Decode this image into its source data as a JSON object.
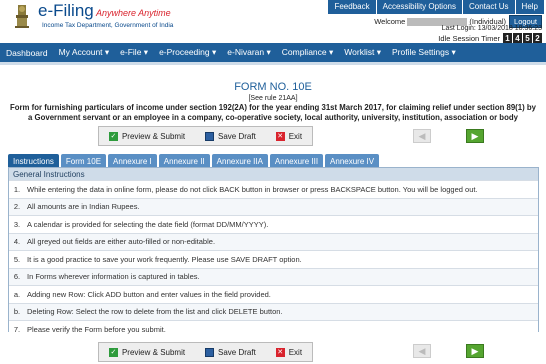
{
  "brand": {
    "name": "e-Filing",
    "tagline": "Anywhere Anytime",
    "subtitle": "Income Tax Department, Government of India"
  },
  "top_links": [
    "Feedback",
    "Accessibility Options",
    "Contact Us",
    "Help"
  ],
  "user": {
    "welcome_label": "Welcome",
    "type_label": "(Individual)",
    "logout_label": "Logout",
    "last_login": "Last Login: 13/03/2018 18:36:23",
    "timer_label": "Idle Session Timer",
    "timer_digits": [
      "1",
      "4",
      "5",
      "2"
    ]
  },
  "nav": [
    "Dashboard",
    "My Account ▾",
    "e-File ▾",
    "e-Proceeding ▾",
    "e-Nivaran ▾",
    "Compliance ▾",
    "Worklist ▾",
    "Profile Settings ▾"
  ],
  "form": {
    "title": "FORM NO. 10E",
    "rule": "[See rule 21AA]",
    "description": "Form for furnishing particulars of income under section 192(2A) for the year ending 31st March 2017, for claiming relief under section 89(1) by a Government servant or an employee in a company, co-operative society, local authority, university, institution, association or body"
  },
  "actions": {
    "preview_submit": "Preview & Submit",
    "save_draft": "Save Draft",
    "exit": "Exit"
  },
  "tabs": [
    "Instructions",
    "Form 10E",
    "Annexure I",
    "Annexure II",
    "Annexure IIA",
    "Annexure III",
    "Annexure IV"
  ],
  "instructions": {
    "heading": "General Instructions",
    "rows": [
      {
        "num": "1.",
        "text": "While entering the data in online form, please do not click BACK button in browser or press BACKSPACE button. You will be logged out."
      },
      {
        "num": "2.",
        "text": "All amounts are in Indian Rupees."
      },
      {
        "num": "3.",
        "text": "A calendar is provided for selecting the date field (format DD/MM/YYYY)."
      },
      {
        "num": "4.",
        "text": "All greyed out fields are either auto-filled or non-editable."
      },
      {
        "num": "5.",
        "text": "It is a good practice to save your work frequently. Please use SAVE DRAFT option."
      },
      {
        "num": "6.",
        "text": "In Forms wherever information is captured in tables."
      },
      {
        "num": "a.",
        "text": "Adding new Row: Click ADD button and enter values in the field provided."
      },
      {
        "num": "b.",
        "text": "Deleting Row: Select the row to delete from the list and click DELETE button."
      },
      {
        "num": "7.",
        "text": "Please verify the Form before you submit."
      }
    ]
  },
  "colors": {
    "primary": "#1f5f9a",
    "tab": "#5a8fc4",
    "accent_red": "#d9232d",
    "next_green": "#55a530"
  }
}
